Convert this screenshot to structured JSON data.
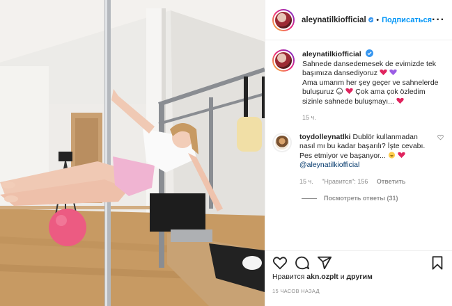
{
  "post": {
    "username": "aleynatilkiofficial",
    "follow_label": "Подписаться",
    "dot": "•",
    "more_label": "···"
  },
  "caption": {
    "username": "aleynatilkiofficial",
    "text": "Sahnede dansedemesek de evimizde tek başımıza dansediyoruz",
    "text2": "Ama umarım her şey geçer ve sahnelerde buluşuruz",
    "text3": "Çok ama çok özledim sizinle sahnede buluşmayı...",
    "time": "15 ч."
  },
  "comment": {
    "username": "toydolleynatlki",
    "text": "Dublör kullanmadan nasıl mı bu kadar başarılı? İşte cevabı. Pes etmiyor ve başanyor...",
    "mention": "@aleynatilkiofficial",
    "time": "15 ч.",
    "likes": "\"Нравится\": 156",
    "reply": "Ответить",
    "view_replies": "Посмотреть ответы (31)"
  },
  "footer": {
    "likes_prefix": "Нравится",
    "liked_by": "akn.ozplt",
    "likes_and": "и",
    "others": "другим",
    "timestamp": "15 ЧАСОВ НАЗАД"
  },
  "icons": {
    "heart": "heart-icon",
    "comment": "comment-icon",
    "share": "share-icon",
    "save": "bookmark-icon",
    "verified": "verified-badge-icon"
  },
  "colors": {
    "link_blue": "#0095f6",
    "verified_blue": "#3897f0",
    "muted": "#8e8e8e",
    "mention": "#00376b"
  }
}
